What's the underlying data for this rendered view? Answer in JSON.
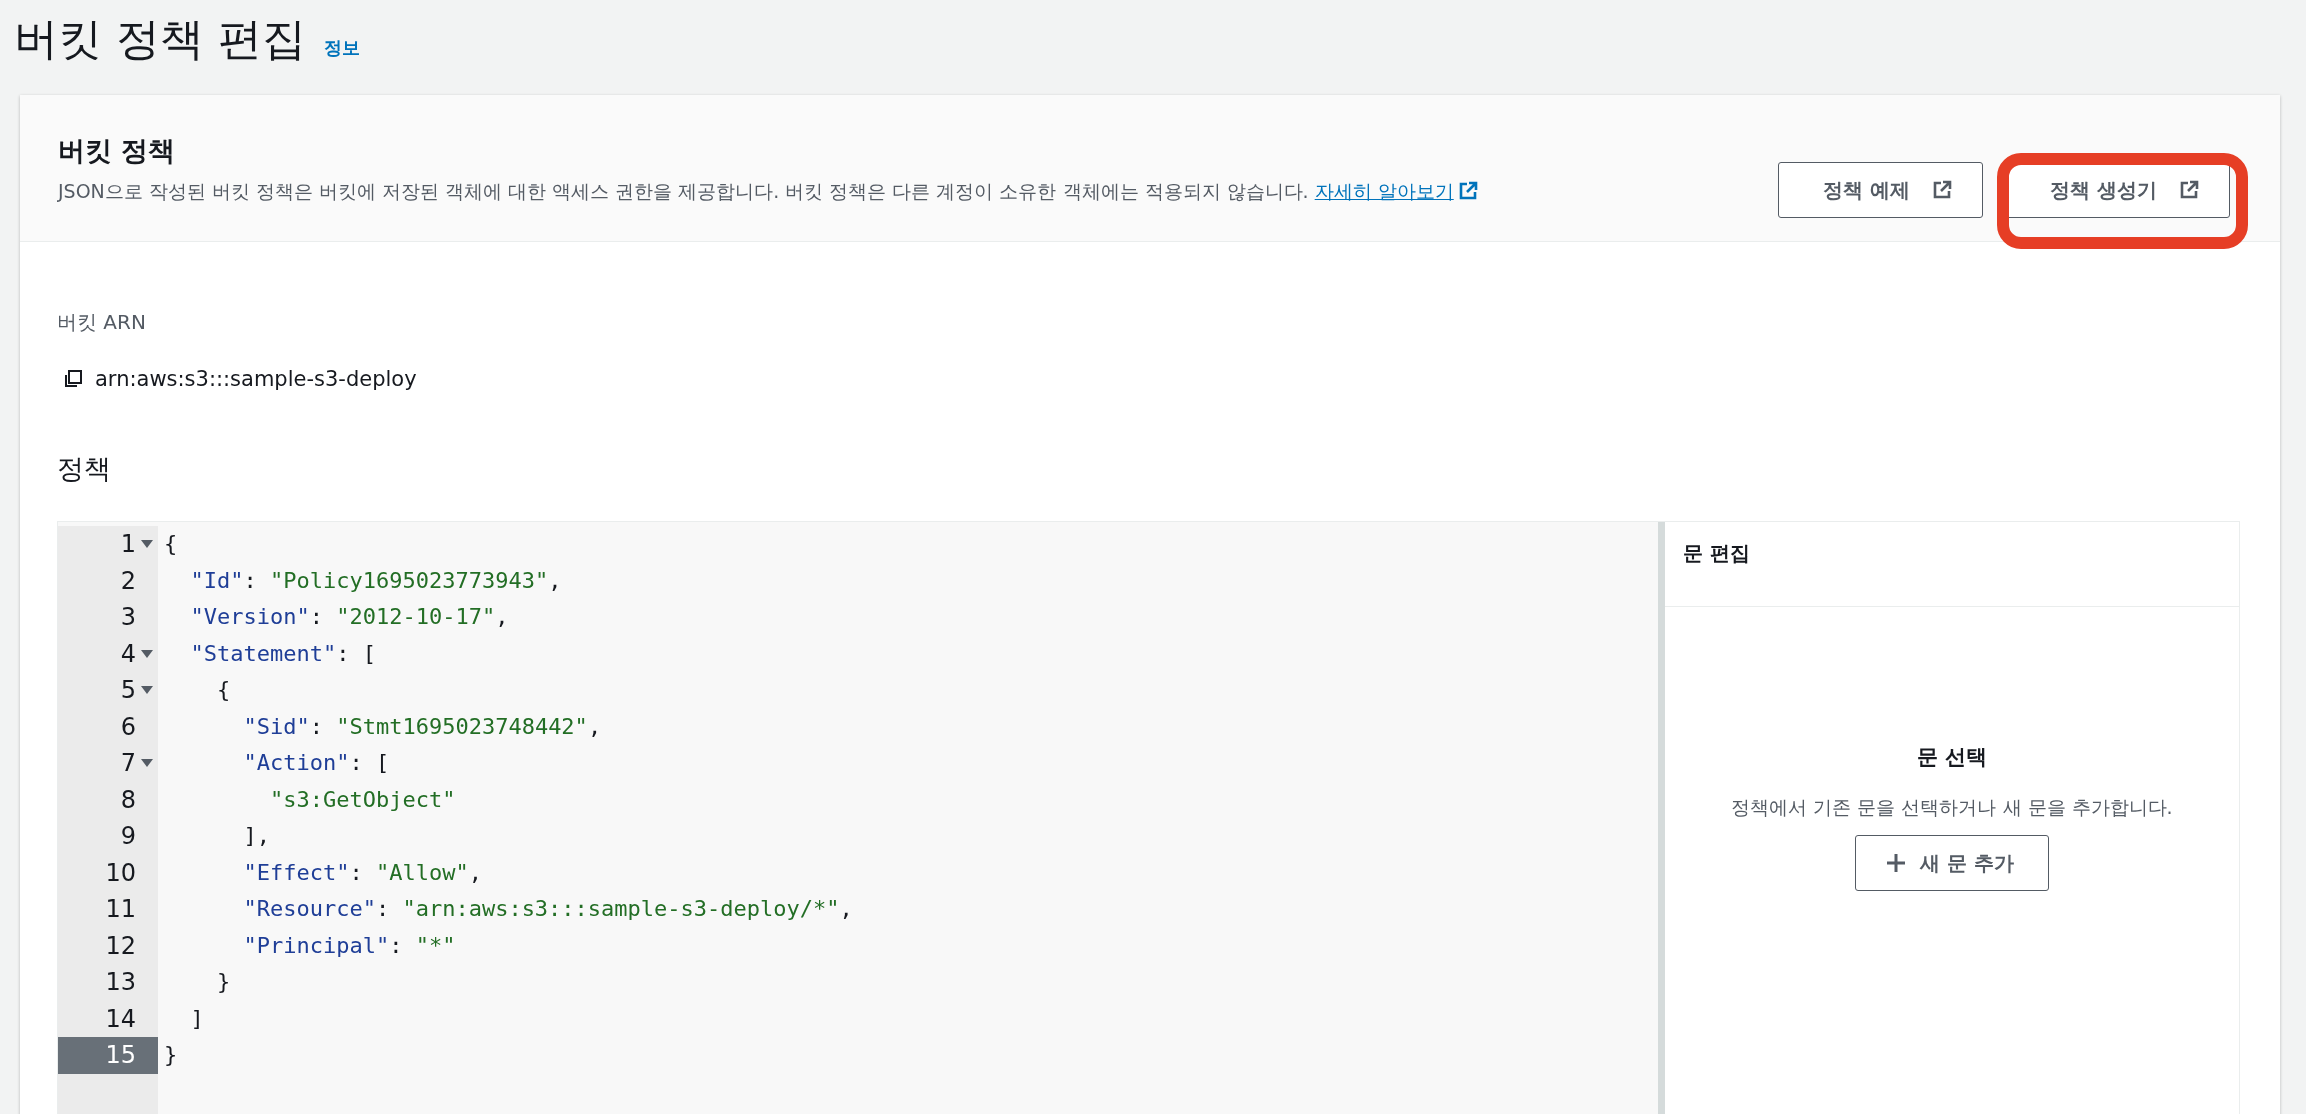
{
  "page": {
    "title": "버킷 정책 편집",
    "info_link": "정보"
  },
  "policy_card": {
    "title": "버킷 정책",
    "description": "JSON으로 작성된 버킷 정책은 버킷에 저장된 객체에 대한 액세스 권한을 제공합니다. 버킷 정책은 다른 계정이 소유한 객체에는 적용되지 않습니다.",
    "learn_more_link": "자세히 알아보기",
    "buttons": [
      {
        "label": "정책 예제",
        "highlighted": false
      },
      {
        "label": "정책 생성기",
        "highlighted": true
      }
    ]
  },
  "bucket_arn": {
    "label": "버킷 ARN",
    "value": "arn:aws:s3:::sample-s3-deploy"
  },
  "policy_heading": "정책",
  "editor": {
    "lines": [
      {
        "number": "1",
        "foldable": true,
        "active": false,
        "tokens": [
          {
            "kind": "punct",
            "text": "{"
          }
        ]
      },
      {
        "number": "2",
        "foldable": false,
        "active": false,
        "tokens": [
          {
            "kind": "key",
            "text": "  \"Id\""
          },
          {
            "kind": "punct",
            "text": ": "
          },
          {
            "kind": "string",
            "text": "\"Policy1695023773943\""
          },
          {
            "kind": "punct",
            "text": ","
          }
        ]
      },
      {
        "number": "3",
        "foldable": false,
        "active": false,
        "tokens": [
          {
            "kind": "key",
            "text": "  \"Version\""
          },
          {
            "kind": "punct",
            "text": ": "
          },
          {
            "kind": "string",
            "text": "\"2012-10-17\""
          },
          {
            "kind": "punct",
            "text": ","
          }
        ]
      },
      {
        "number": "4",
        "foldable": true,
        "active": false,
        "tokens": [
          {
            "kind": "key",
            "text": "  \"Statement\""
          },
          {
            "kind": "punct",
            "text": ": ["
          }
        ]
      },
      {
        "number": "5",
        "foldable": true,
        "active": false,
        "tokens": [
          {
            "kind": "punct",
            "text": "    {"
          }
        ]
      },
      {
        "number": "6",
        "foldable": false,
        "active": false,
        "tokens": [
          {
            "kind": "key",
            "text": "      \"Sid\""
          },
          {
            "kind": "punct",
            "text": ": "
          },
          {
            "kind": "string",
            "text": "\"Stmt1695023748442\""
          },
          {
            "kind": "punct",
            "text": ","
          }
        ]
      },
      {
        "number": "7",
        "foldable": true,
        "active": false,
        "tokens": [
          {
            "kind": "key",
            "text": "      \"Action\""
          },
          {
            "kind": "punct",
            "text": ": ["
          }
        ]
      },
      {
        "number": "8",
        "foldable": false,
        "active": false,
        "tokens": [
          {
            "kind": "string",
            "text": "        \"s3:GetObject\""
          }
        ]
      },
      {
        "number": "9",
        "foldable": false,
        "active": false,
        "tokens": [
          {
            "kind": "punct",
            "text": "      ],"
          }
        ]
      },
      {
        "number": "10",
        "foldable": false,
        "active": false,
        "tokens": [
          {
            "kind": "key",
            "text": "      \"Effect\""
          },
          {
            "kind": "punct",
            "text": ": "
          },
          {
            "kind": "string",
            "text": "\"Allow\""
          },
          {
            "kind": "punct",
            "text": ","
          }
        ]
      },
      {
        "number": "11",
        "foldable": false,
        "active": false,
        "tokens": [
          {
            "kind": "key",
            "text": "      \"Resource\""
          },
          {
            "kind": "punct",
            "text": ": "
          },
          {
            "kind": "string",
            "text": "\"arn:aws:s3:::sample-s3-deploy/*\""
          },
          {
            "kind": "punct",
            "text": ","
          }
        ]
      },
      {
        "number": "12",
        "foldable": false,
        "active": false,
        "tokens": [
          {
            "kind": "key",
            "text": "      \"Principal\""
          },
          {
            "kind": "punct",
            "text": ": "
          },
          {
            "kind": "string",
            "text": "\"*\""
          }
        ]
      },
      {
        "number": "13",
        "foldable": false,
        "active": false,
        "tokens": [
          {
            "kind": "punct",
            "text": "    }"
          }
        ]
      },
      {
        "number": "14",
        "foldable": false,
        "active": false,
        "tokens": [
          {
            "kind": "punct",
            "text": "  ]"
          }
        ]
      },
      {
        "number": "15",
        "foldable": false,
        "active": true,
        "tokens": [
          {
            "kind": "punct",
            "text": "}"
          }
        ]
      }
    ]
  },
  "statement_panel": {
    "title": "문 편집",
    "empty_title": "문 선택",
    "empty_description": "정책에서 기존 문을 선택하거나 새 문을 추가합니다.",
    "add_button": "새 문 추가"
  }
}
